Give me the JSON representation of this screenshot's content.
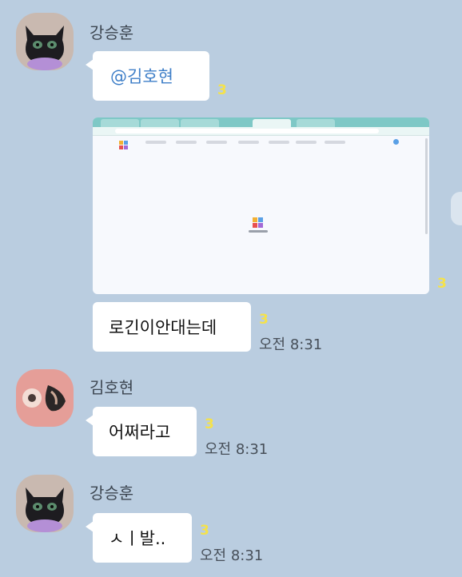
{
  "messages": [
    {
      "sender": "강승훈",
      "avatar": "black-cat-plush-icon",
      "items": [
        {
          "type": "text",
          "text": "@김호현",
          "unread": "3"
        },
        {
          "type": "image",
          "unread": "3"
        },
        {
          "type": "text",
          "text": "로긴이안대는데",
          "unread": "3",
          "time": "오전 8:31"
        }
      ]
    },
    {
      "sender": "김호현",
      "avatar": "pink-donut-photo-icon",
      "items": [
        {
          "type": "text",
          "text": "어쩌라고",
          "unread": "3",
          "time": "오전 8:31"
        }
      ]
    },
    {
      "sender": "강승훈",
      "avatar": "black-cat-plush-icon",
      "items": [
        {
          "type": "text",
          "text": "ㅅㅣ발..",
          "unread": "3",
          "time": "오전 8:31"
        }
      ]
    }
  ],
  "colors": {
    "background": "#bacde0",
    "bubble": "#ffffff",
    "mention": "#3f7fc8",
    "unread": "#f5e24a"
  }
}
